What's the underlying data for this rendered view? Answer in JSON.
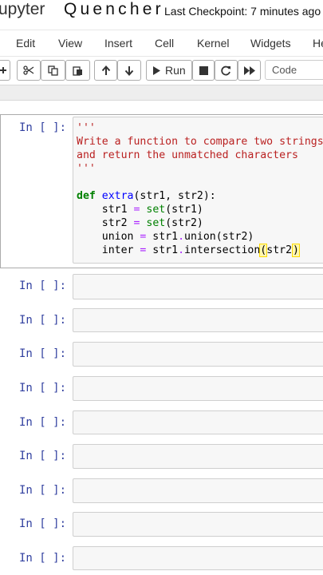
{
  "header": {
    "brand": "upyter",
    "notebook_name": "Quencher",
    "checkpoint": "Last Checkpoint: 7 minutes ago"
  },
  "menubar": {
    "items": [
      "Edit",
      "View",
      "Insert",
      "Cell",
      "Kernel",
      "Widgets",
      "He"
    ]
  },
  "toolbar": {
    "run_label": "Run",
    "cell_type": "Code",
    "icons": [
      "plus-icon",
      "cut-icon",
      "copy-icon",
      "paste-icon",
      "arrow-up-icon",
      "arrow-down-icon",
      "run-icon",
      "stop-icon",
      "restart-icon",
      "fast-forward-icon"
    ]
  },
  "cells": {
    "active": {
      "prompt": "In [ ]:",
      "lines": {
        "l1": "'''",
        "l2": "Write a function to compare two strings",
        "l3": "and return the unmatched characters",
        "l4": "'''",
        "l6_kw": "def",
        "l6_fn": "extra",
        "l6_rest": "(str1, str2):",
        "l7_a": "    str1 ",
        "l7_op": "=",
        "l7_b": " ",
        "l7_bi": "set",
        "l7_c": "(str1)",
        "l8_a": "    str2 ",
        "l8_op": "=",
        "l8_b": " ",
        "l8_bi": "set",
        "l8_c": "(str2)",
        "l9_a": "    union ",
        "l9_op": "=",
        "l9_b": " str1",
        "l9_op2": ".",
        "l9_c": "union(str2)",
        "l10_a": "    inter ",
        "l10_op": "=",
        "l10_b": " str1",
        "l10_op2": ".",
        "l10_c": "intersection",
        "l10_d": "(",
        "l10_e": "str2",
        "l10_f": ")"
      }
    },
    "empty_prompt": "In [ ]:"
  }
}
